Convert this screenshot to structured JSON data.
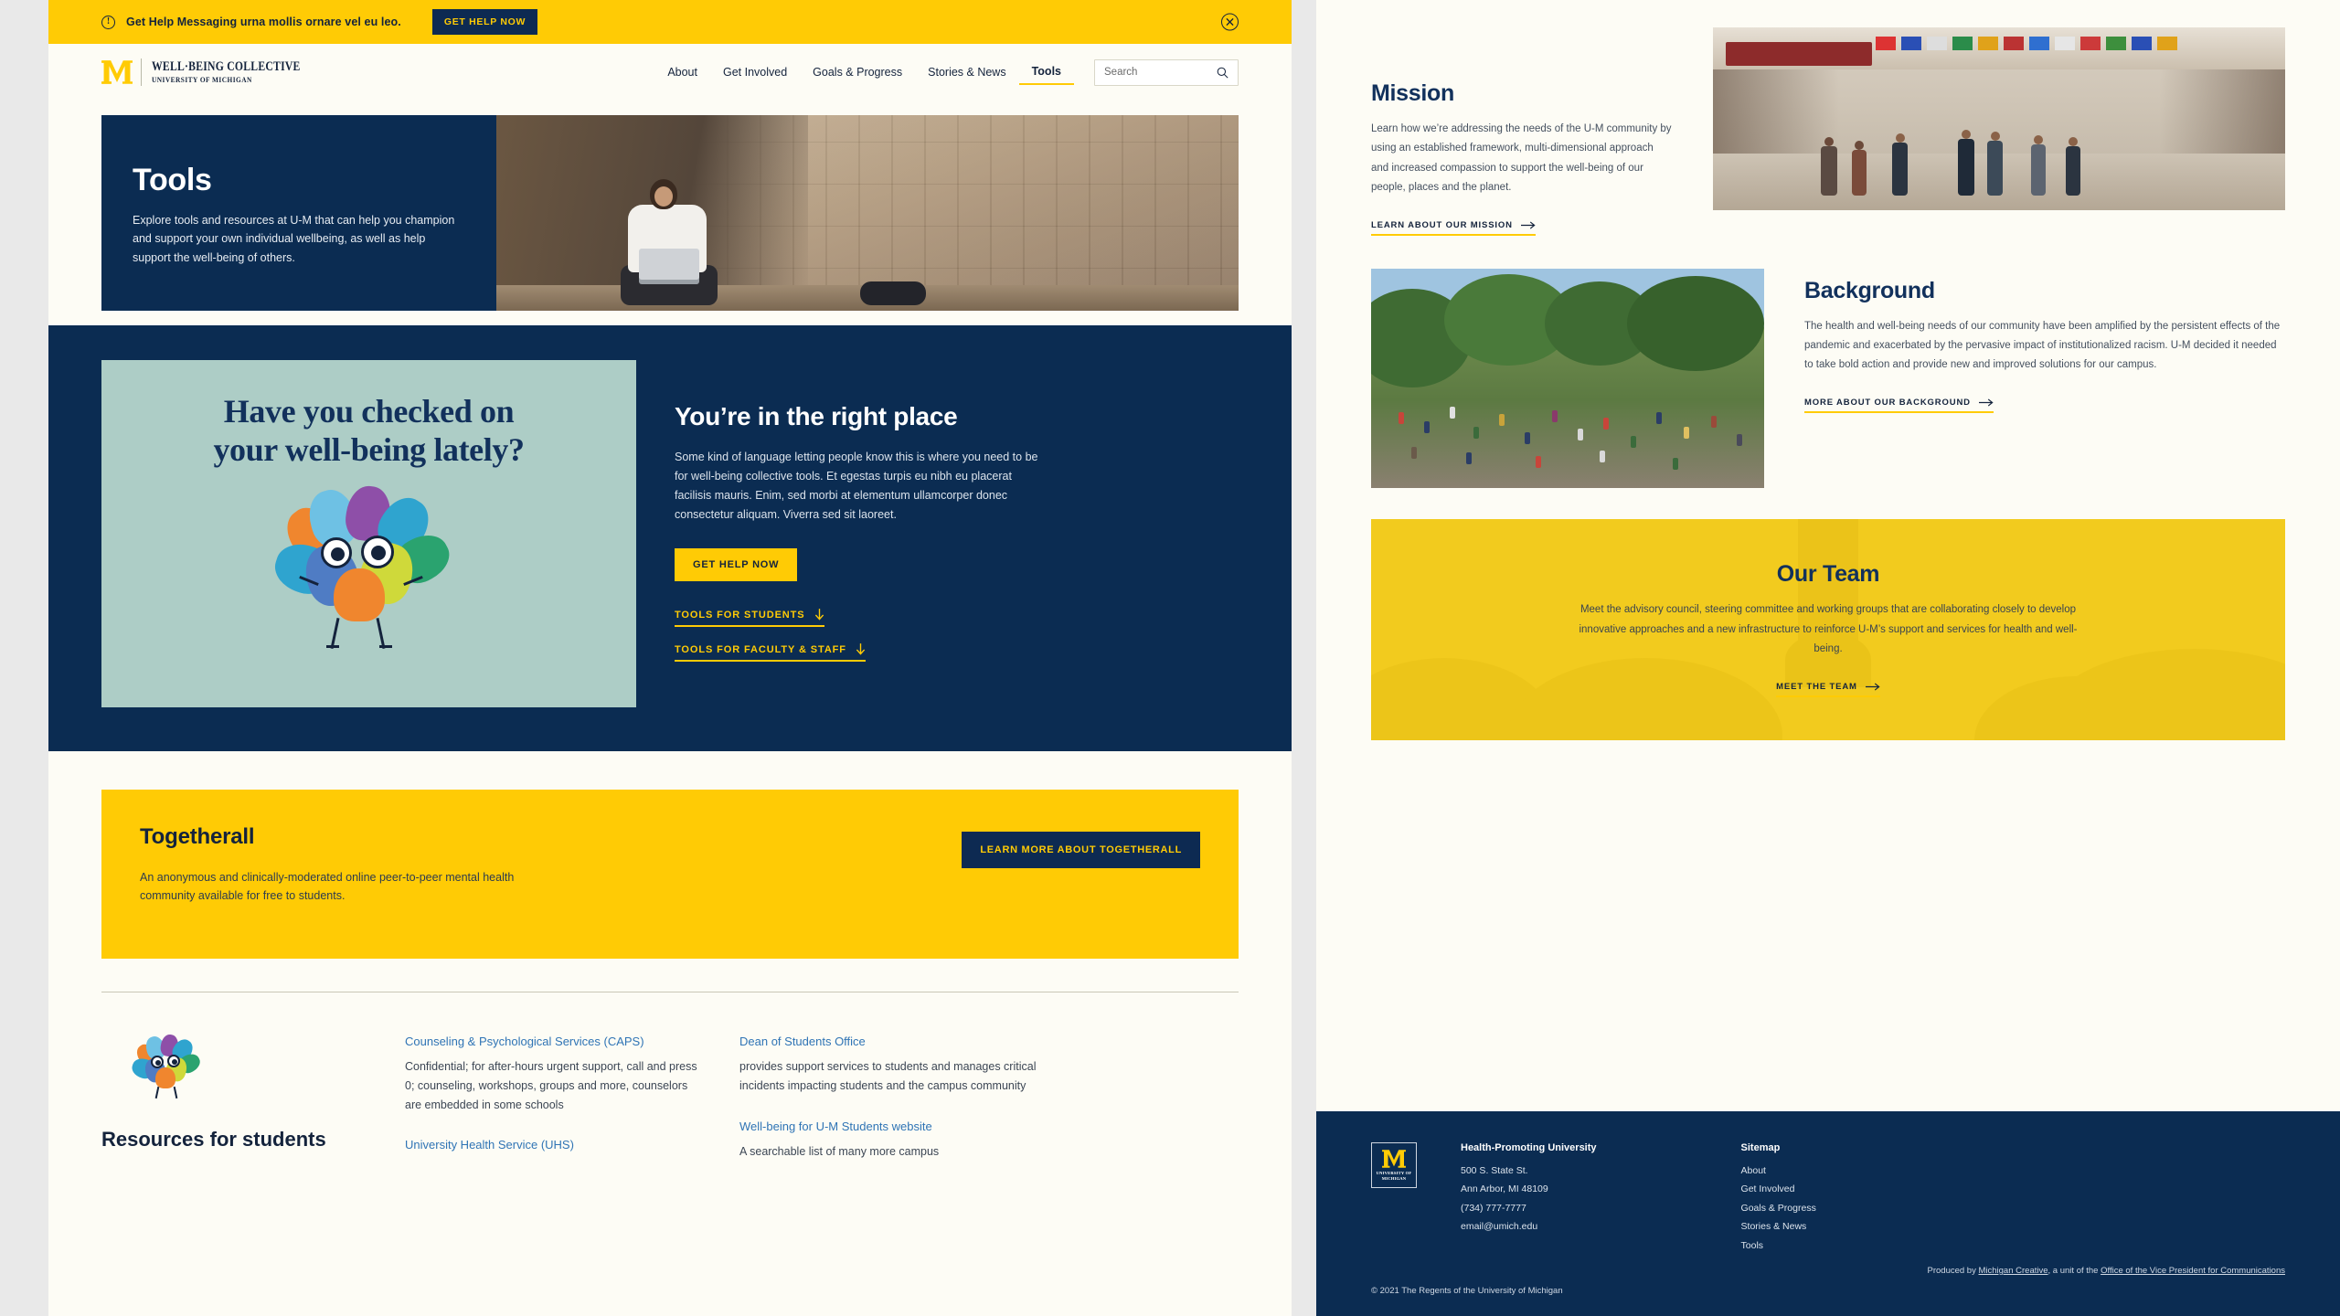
{
  "colors": {
    "maize": "#ffcb05",
    "blue": "#0b2c52",
    "deep_blue": "#12315c",
    "mint": "#adcdc6",
    "link_blue": "#2f74b5",
    "page_bg": "#fdfcf5"
  },
  "alert": {
    "icon": "alert-circle-icon",
    "text": "Get Help Messaging urna mollis ornare vel eu leo.",
    "button": "GET HELP NOW",
    "close_icon": "close-circle-icon"
  },
  "header": {
    "logo_mark": "block-m-icon",
    "brand_title": "WELL·BEING COLLECTIVE",
    "brand_sub": "UNIVERSITY OF MICHIGAN",
    "nav": [
      {
        "label": "About",
        "active": false
      },
      {
        "label": "Get Involved",
        "active": false
      },
      {
        "label": "Goals & Progress",
        "active": false
      },
      {
        "label": "Stories & News",
        "active": false
      },
      {
        "label": "Tools",
        "active": true
      }
    ],
    "search": {
      "placeholder": "Search",
      "value": "",
      "icon": "search-icon"
    }
  },
  "hero": {
    "title": "Tools",
    "description": "Explore tools and resources at U-M that can help you champion and support your own individual wellbeing, as well as help support the well-being of others.",
    "image_alt": "student-with-laptop-photo"
  },
  "promo": {
    "headline_line1": "Have you checked on",
    "headline_line2": "your well-being lately?",
    "mascot_alt": "leaf-mascot-illustration"
  },
  "right_place": {
    "title": "You’re in the right place",
    "description": "Some kind of language letting people know this is where you need to be for well-being collective tools. Et egestas turpis eu nibh eu placerat facilisis mauris. Enim, sed morbi at elementum ullamcorper donec consectetur aliquam. Viverra sed sit laoreet.",
    "primary_button": "GET HELP NOW",
    "link_students": "TOOLS FOR STUDENTS",
    "link_faculty": "TOOLS FOR FACULTY & STAFF",
    "arrow_icon": "arrow-down-icon"
  },
  "togetherall": {
    "title": "Togetherall",
    "description": "An anonymous and clinically-moderated online peer-to-peer mental health community available for free to students.",
    "button": "LEARN MORE ABOUT TOGETHERALL"
  },
  "resources": {
    "heading": "Resources for students",
    "mascot_alt": "leaf-mascot-small-illustration",
    "column1": [
      {
        "link": "Counseling & Psychological Services (CAPS)",
        "body": "Confidential; for after-hours urgent support, call and press 0; counseling, workshops, groups and more, counselors are embedded in some schools"
      },
      {
        "link": "University Health Service (UHS)",
        "body": ""
      }
    ],
    "column2": [
      {
        "link": "Dean of Students Office",
        "body": "provides support services to students and manages critical incidents impacting students and the campus community"
      },
      {
        "link": "Well-being for U-M Students website",
        "body": "A searchable list of many more campus"
      }
    ]
  },
  "mission": {
    "title": "Mission",
    "description": "Learn how we’re addressing the needs of the U-M community by using an established framework, multi-dimensional approach and increased compassion to support the well-being of our people, places and the planet.",
    "link": "LEARN ABOUT OUR MISSION",
    "arrow_icon": "arrow-right-icon",
    "image_alt": "international-flags-corridor-photo"
  },
  "background": {
    "title": "Background",
    "description": "The health and well-being needs of our community have been amplified by the persistent effects of the pandemic and exacerbated by the pervasive impact of institutionalized racism. U-M decided it needed to take bold action and provide new and improved solutions for our campus.",
    "link": "MORE ABOUT OUR BACKGROUND",
    "arrow_icon": "arrow-right-icon",
    "image_alt": "campus-outdoor-gathering-photo"
  },
  "team": {
    "title": "Our Team",
    "description": "Meet the advisory council, steering committee and working groups that are collaborating closely to develop innovative approaches and a new infrastructure to reinforce U-M’s support and services for health and well-being.",
    "link": "MEET THE TEAM",
    "arrow_icon": "arrow-right-icon",
    "image_alt": "burton-tower-yellow-overlay-photo"
  },
  "footer": {
    "logo_mark": "block-m-icon",
    "logo_sub_line1": "UNIVERSITY OF",
    "logo_sub_line2": "MICHIGAN",
    "address_title": "Health-Promoting University",
    "address_line1": "500 S. State St.",
    "address_line2": "Ann Arbor, MI 48109",
    "phone": "(734) 777-7777",
    "email": "email@umich.edu",
    "sitemap_title": "Sitemap",
    "sitemap": [
      "About",
      "Get Involved",
      "Goals & Progress",
      "Stories & News",
      "Tools"
    ],
    "copyright": "© 2021 The Regents of the University of Michigan",
    "produced_prefix": "Produced by ",
    "produced_link1": "Michigan Creative",
    "produced_mid": ", a unit of the ",
    "produced_link2": "Office of the Vice President for Communications"
  }
}
